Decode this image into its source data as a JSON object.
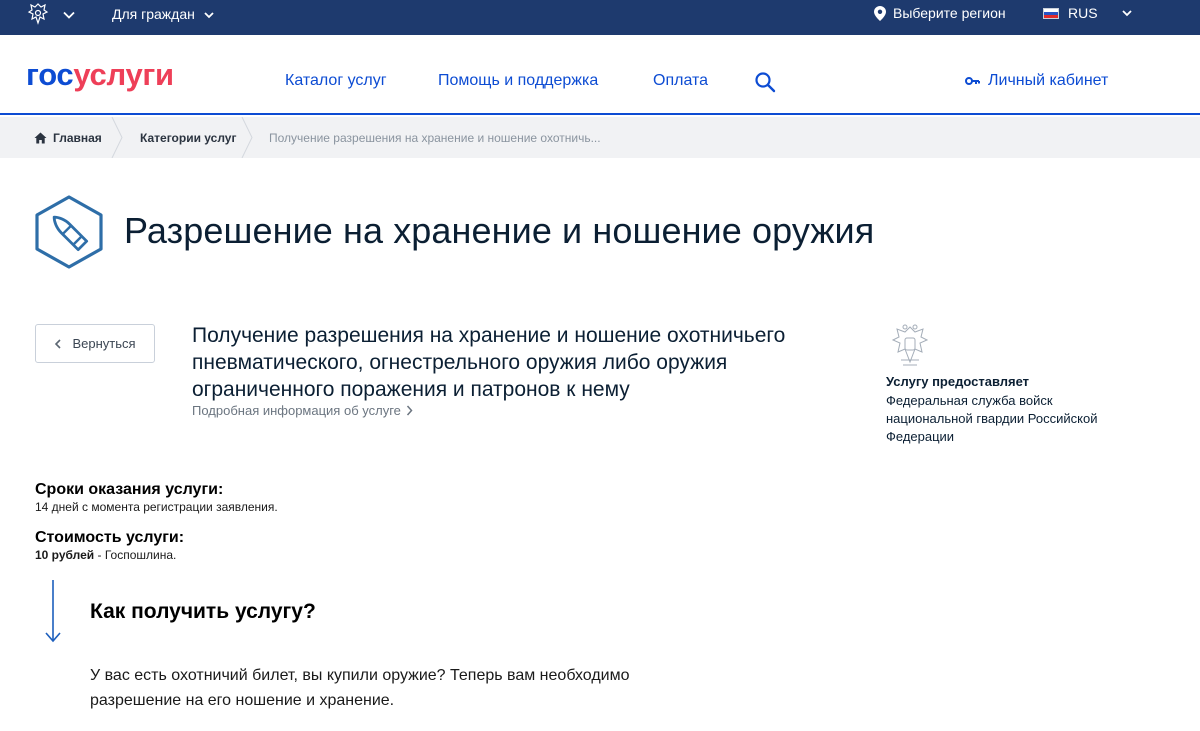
{
  "topbar": {
    "audience_label": "Для граждан",
    "region_label": "Выберите регион",
    "language": "RUS"
  },
  "header": {
    "logo_part1": "гос",
    "logo_part2": "услуги",
    "nav": [
      "Каталог услуг",
      "Помощь и поддержка",
      "Оплата"
    ],
    "cabinet_label": "Личный кабинет"
  },
  "breadcrumbs": {
    "home": "Главная",
    "categories": "Категории услуг",
    "current": "Получение разрешения на хранение и ношение охотничь..."
  },
  "page": {
    "title": "Разрешение на хранение и ношение оружия",
    "back_label": "Вернуться"
  },
  "service": {
    "title": "Получение разрешения на хранение и ношение охотничьего пневматического, огнестрельного оружия либо оружия ограниченного поражения и патронов к нему",
    "details_link": "Подробная информация об услуге"
  },
  "provider": {
    "label": "Услугу предоставляет",
    "name": "Федеральная служба войск национальной гвардии Российской Федерации"
  },
  "terms": {
    "heading": "Сроки оказания услуги:",
    "text": "14 дней с момента регистрации заявления."
  },
  "cost": {
    "heading": "Стоимость услуги:",
    "amount": "10 рублей",
    "suffix": " - Госпошлина."
  },
  "how": {
    "heading": "Как получить услугу?",
    "text": "У вас есть охотничий билет, вы купили оружие? Теперь вам необходимо разрешение на его ношение и хранение."
  },
  "colors": {
    "topbar_bg": "#1e3a6e",
    "brand_blue": "#0d4cd3",
    "brand_red": "#ee3f58",
    "icon_blue": "#2e6ea8",
    "crumbs_bg": "#f1f2f4"
  },
  "icons": [
    "emblem-icon",
    "chevron-down-icon",
    "location-pin-icon",
    "flag-ru-icon",
    "search-icon",
    "key-icon",
    "home-icon",
    "bullet-icon",
    "chevron-left-icon",
    "chevron-right-icon",
    "arrow-down-icon"
  ]
}
